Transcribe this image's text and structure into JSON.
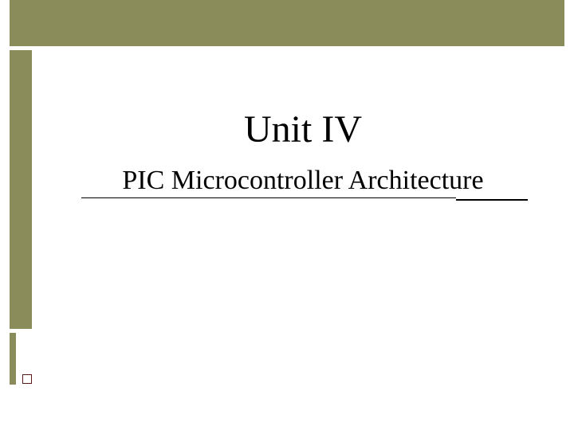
{
  "slide": {
    "title": "Unit IV",
    "subtitle": "PIC Microcontroller  Architecture"
  },
  "theme": {
    "accent": "#8a8c5a",
    "square_border": "#5a1a1a",
    "text_color": "#000000",
    "background": "#ffffff"
  }
}
